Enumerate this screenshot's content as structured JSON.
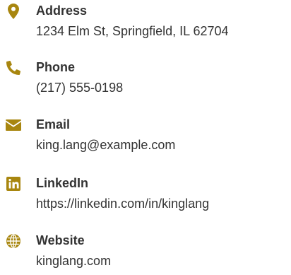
{
  "accent_color": "#a8860f",
  "contacts": [
    {
      "icon": "map-pin-icon",
      "label": "Address",
      "value": "1234 Elm St, Springfield, IL 62704"
    },
    {
      "icon": "phone-icon",
      "label": "Phone",
      "value": "(217) 555-0198"
    },
    {
      "icon": "envelope-icon",
      "label": "Email",
      "value": "king.lang@example.com"
    },
    {
      "icon": "linkedin-icon",
      "label": "LinkedIn",
      "value": "https://linkedin.com/in/kinglang"
    },
    {
      "icon": "globe-icon",
      "label": "Website",
      "value": "kinglang.com"
    }
  ]
}
